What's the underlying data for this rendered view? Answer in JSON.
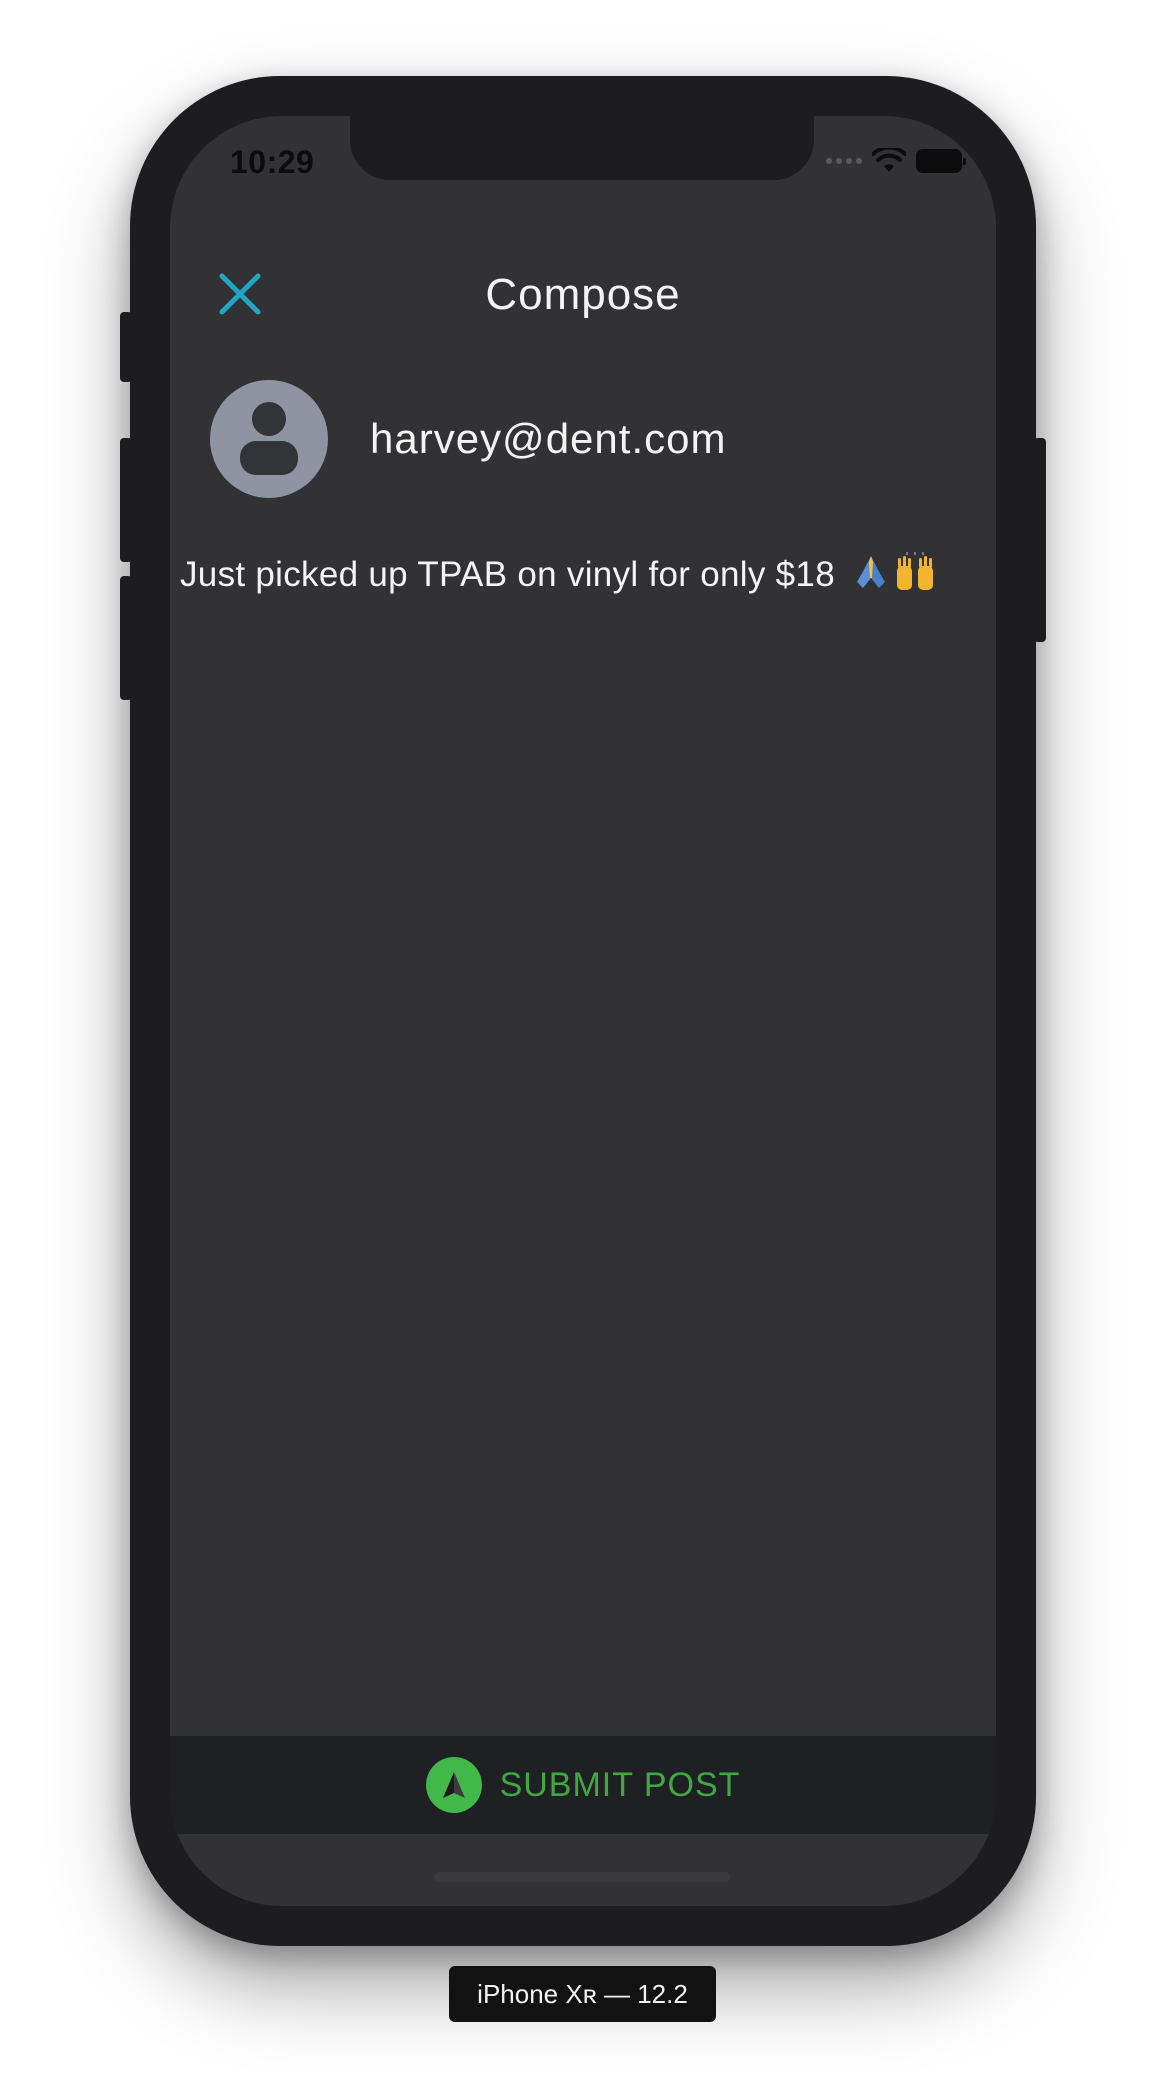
{
  "status_bar": {
    "time": "10:29"
  },
  "nav": {
    "title": "Compose",
    "close_icon": "close-icon"
  },
  "author": {
    "email": "harvey@dent.com",
    "avatar_icon": "person-icon"
  },
  "post": {
    "text": "Just picked up TPAB on vinyl for only $18",
    "emojis": [
      "folded-hands-emoji",
      "raised-hands-emoji"
    ]
  },
  "submit": {
    "label": "SUBMIT POST",
    "icon": "paper-plane-icon"
  },
  "device": {
    "label": "iPhone Xʀ — 12.2"
  },
  "colors": {
    "accent_close": "#1fa6c4",
    "submit_green": "#41b84a",
    "screen_bg": "#323234",
    "submit_bar_bg": "#1f2023"
  }
}
